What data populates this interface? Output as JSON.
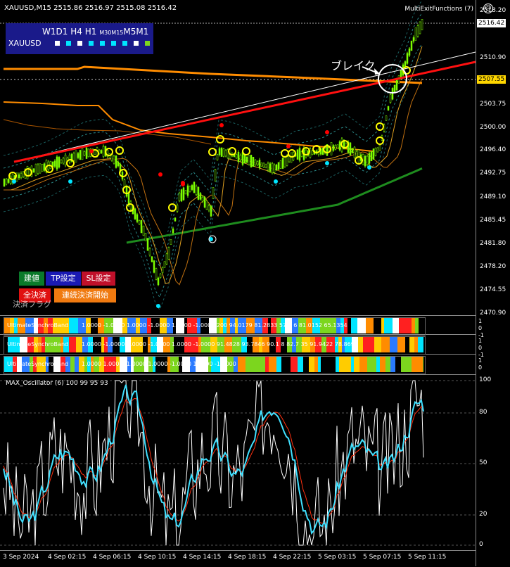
{
  "header": {
    "symbol_tf": "XAUUSD,M15",
    "ohlc": "2515.86 2516.97 2515.08 2516.42",
    "ea_name": "MultiExitFunctions (7)",
    "smile": "☺"
  },
  "timeframes": {
    "w1": "W1",
    "d1": "D1",
    "h4": "H4",
    "h1": "H1",
    "m30": "M30",
    "m15": "M15",
    "m5": "M5",
    "m1": "M1",
    "symbol": "XAUUSD",
    "squares": [
      "#ffffff",
      "#00e5ff",
      "#ffffff",
      "#00e5ff",
      "#00e5ff",
      "#00e5ff",
      "#00e5ff",
      "#ffffff",
      "#7cd61e"
    ]
  },
  "price_axis": {
    "ticks": [
      "2518.20",
      "2510.90",
      "2503.75",
      "2500.00",
      "2496.40",
      "2492.75",
      "2489.10",
      "2485.45",
      "2481.80",
      "2478.20",
      "2474.55",
      "2470.90"
    ],
    "current_price": "2516.42",
    "line_price": "2507.55"
  },
  "time_axis": {
    "ticks": [
      "3 Sep 2024",
      "4 Sep 02:15",
      "4 Sep 06:15",
      "4 Sep 10:15",
      "4 Sep 14:15",
      "4 Sep 18:15",
      "4 Sep 22:15",
      "5 Sep 03:15",
      "5 Sep 07:15",
      "5 Sep 11:15"
    ]
  },
  "annotation": {
    "break_text": "ブレイク"
  },
  "buttons": {
    "open": "建値",
    "tp": "TP設定",
    "sl": "SL設定",
    "close_all": "全決済",
    "continuous": "連続決済開始"
  },
  "ghost_text": "決済フラグ",
  "bands": [
    {
      "label": "UltimateSynchroBand",
      "values": "1.0000 -1.0000 1.0000 -1.0000 1.0000 -1.0000   200 94.0179 81.2833 57.1 6 81.0152 65.1354"
    },
    {
      "label": "UltimateSynchroBand",
      "values": "1.0000 -1.0000 1.0000 -1.0000 1.0000 -1.0000 91.4828 93.7846 90.1 8 82.7 35 91.9422 78.8694"
    },
    {
      "label": "UltimateSynchroBand",
      "values": "1.0000 1.0000 -1.0000 1.0000 -1.0000 1.0000 -1.0000"
    }
  ],
  "band_side": [
    "1",
    "0",
    "-1"
  ],
  "oscillator": {
    "label": "MAX_Oscillator (6) 100 99 95 93",
    "levels": [
      "100",
      "80",
      "50",
      "20",
      "0"
    ]
  },
  "colors": {
    "background": "#000000",
    "candle": "#7cfc00",
    "ma_orange": "#ff8c00",
    "trend_red": "#ff1010",
    "trend_white": "#ffffff",
    "ma_green": "#1e8c1e",
    "signal_yellow": "#ffff00",
    "signal_red": "#ff0000",
    "signal_cyan": "#00e5ff",
    "osc_white": "#ffffff",
    "osc_red": "#ff3010",
    "osc_cyan": "#40e0ff"
  }
}
